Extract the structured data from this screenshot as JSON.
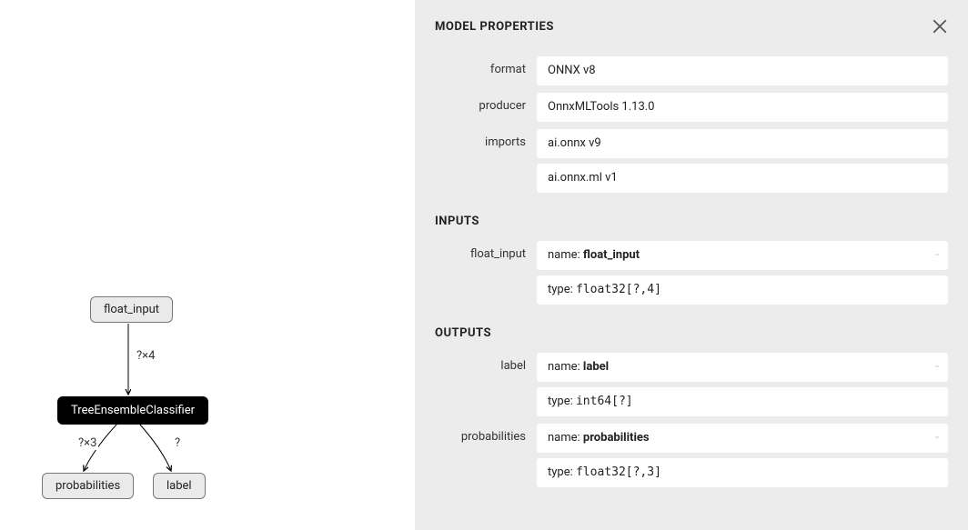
{
  "panel": {
    "title": "MODEL PROPERTIES",
    "close_tooltip": "Close",
    "sections": {
      "inputs_label": "INPUTS",
      "outputs_label": "OUTPUTS"
    },
    "meta": [
      {
        "label": "format",
        "values": [
          "ONNX v8"
        ]
      },
      {
        "label": "producer",
        "values": [
          "OnnxMLTools 1.13.0"
        ]
      },
      {
        "label": "imports",
        "values": [
          "ai.onnx v9",
          "ai.onnx.ml v1"
        ]
      }
    ],
    "inputs": [
      {
        "label": "float_input",
        "name_prefix": "name: ",
        "name_value": "float_input",
        "type_prefix": "type: ",
        "type_value": "float32[?,4]",
        "dash": "-"
      }
    ],
    "outputs": [
      {
        "label": "label",
        "name_prefix": "name: ",
        "name_value": "label",
        "type_prefix": "type: ",
        "type_value": "int64[?]",
        "dash": "-"
      },
      {
        "label": "probabilities",
        "name_prefix": "name: ",
        "name_value": "probabilities",
        "type_prefix": "type: ",
        "type_value": "float32[?,3]",
        "dash": "-"
      }
    ]
  },
  "graph": {
    "nodes": {
      "input": "float_input",
      "op": "TreeEnsembleClassifier",
      "out1": "probabilities",
      "out2": "label"
    },
    "edges": {
      "in_to_op": "?×4",
      "op_to_out1": "?×3",
      "op_to_out2": "?"
    }
  }
}
